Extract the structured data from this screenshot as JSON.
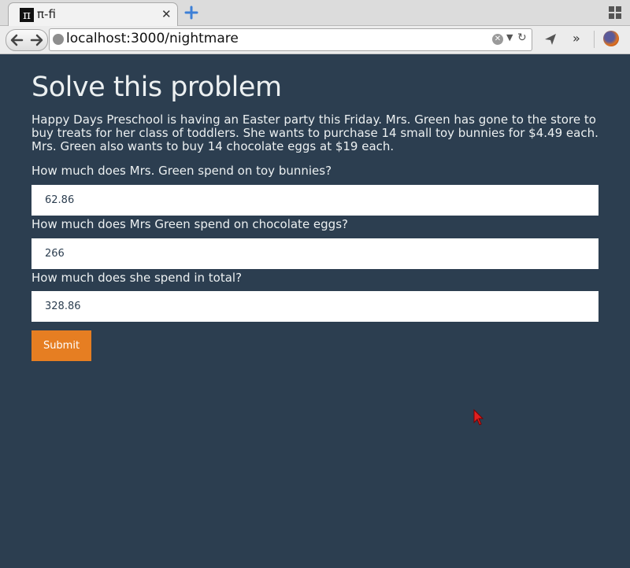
{
  "browser": {
    "tab_title": "π-fi",
    "tab_icon_glyph": "π",
    "url": "localhost:3000/nightmare"
  },
  "page": {
    "title": "Solve this problem",
    "problem_text": "Happy Days Preschool is having an Easter party this Friday. Mrs. Green has gone to the store to buy treats for her class of toddlers. She wants to purchase 14 small toy bunnies for $4.49 each. Mrs. Green also wants to buy 14 chocolate eggs at $19 each.",
    "questions": [
      {
        "label": "How much does Mrs. Green spend on toy bunnies?",
        "value": "62.86"
      },
      {
        "label": "How much does Mrs Green spend on chocolate eggs?",
        "value": "266"
      },
      {
        "label": "How much does she spend in total?",
        "value": "328.86"
      }
    ],
    "submit_label": "Submit"
  },
  "colors": {
    "background": "#2c3e50",
    "text": "#ecf0f1",
    "submit_button": "#e67e22"
  }
}
